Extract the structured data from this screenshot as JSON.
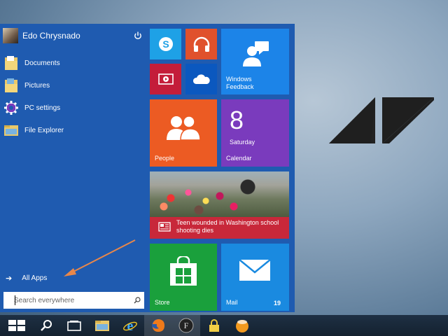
{
  "user": {
    "name": "Edo Chrysnado"
  },
  "nav": [
    {
      "label": "Documents",
      "icon": "documents-folder-icon"
    },
    {
      "label": "Pictures",
      "icon": "pictures-folder-icon"
    },
    {
      "label": "PC settings",
      "icon": "gear-icon"
    },
    {
      "label": "File Explorer",
      "icon": "file-explorer-icon"
    }
  ],
  "all_apps": {
    "label": "All Apps"
  },
  "search": {
    "placeholder": "Search everywhere"
  },
  "tiles": {
    "feedback": {
      "label": "Windows\nFeedback"
    },
    "people": {
      "label": "People"
    },
    "calendar": {
      "day": "8",
      "weekday": "Saturday",
      "label": "Calendar"
    },
    "news": {
      "headline": "Teen wounded in Washington school shooting dies"
    },
    "store": {
      "label": "Store"
    },
    "mail": {
      "label": "Mail",
      "count": "19"
    }
  },
  "colors": {
    "start_bg": "#1f5bb0",
    "skype": "#1ea1e6",
    "music": "#e0512c",
    "video": "#c41d3a",
    "onedrive": "#0b58bf",
    "feedback": "#1c84e8",
    "people": "#ec5b23",
    "calendar": "#7a3bbd",
    "news": "#c8283a",
    "store": "#1aa03c",
    "mail": "#1a8ae0",
    "annotation_arrow": "#e8874a"
  },
  "taskbar": [
    "start-icon",
    "search-icon",
    "task-view-icon",
    "file-explorer-icon",
    "internet-explorer-icon",
    "firefox-icon",
    "f-app-icon",
    "lock-icon",
    "ball-app-icon"
  ]
}
